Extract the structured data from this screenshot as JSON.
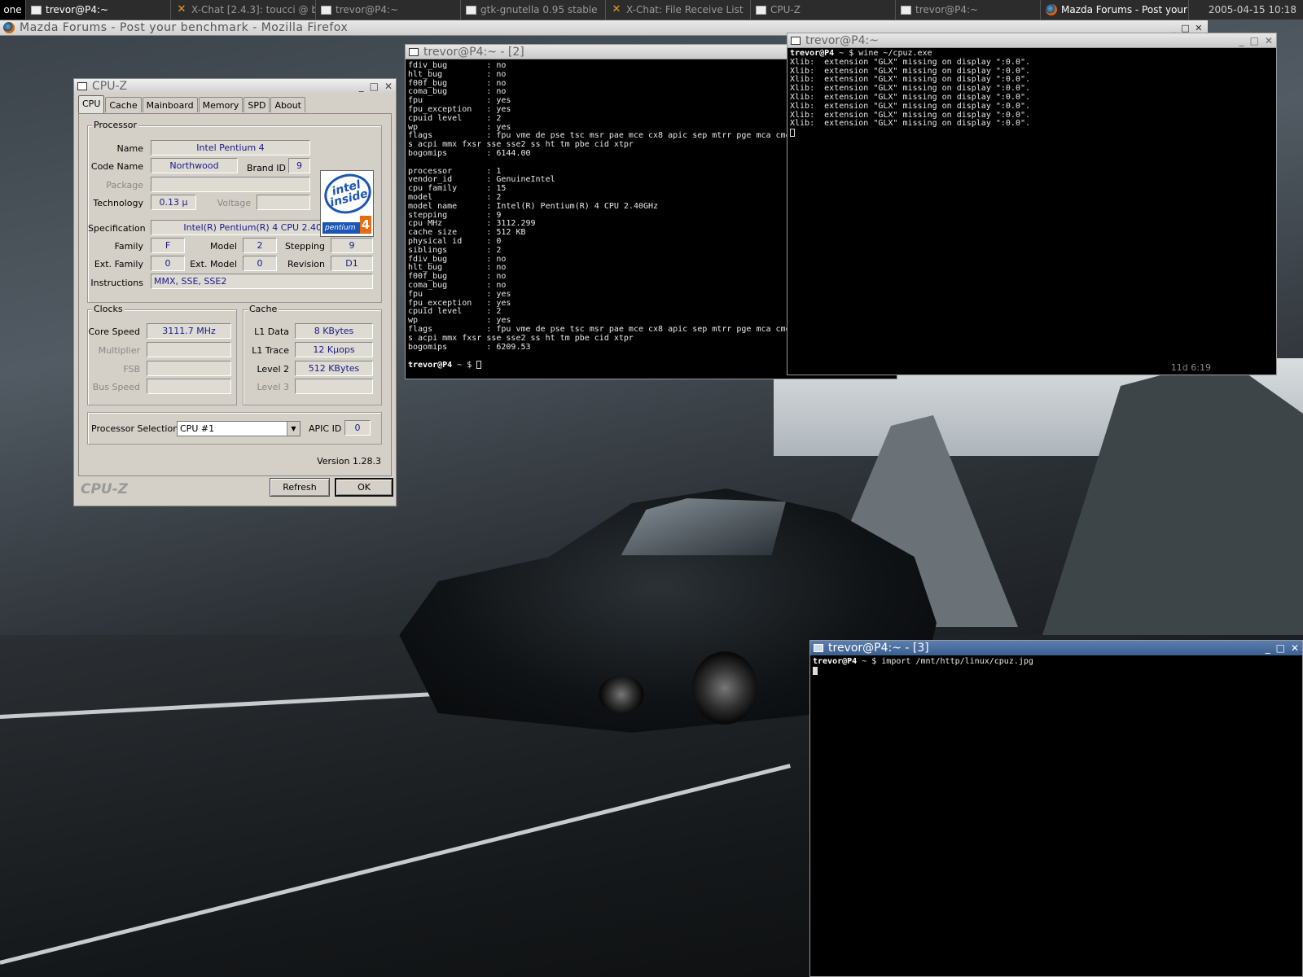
{
  "taskbar": {
    "workspace": "one",
    "tasks": [
      {
        "label": "trevor@P4:~",
        "icon": "terminal-icon"
      },
      {
        "label": "X-Chat [2.4.3]: toucci @ b",
        "icon": "xchat-icon"
      },
      {
        "label": "trevor@P4:~",
        "icon": "terminal-icon"
      },
      {
        "label": "gtk-gnutella 0.95 stable",
        "icon": "window-icon"
      },
      {
        "label": "X-Chat: File Receive List",
        "icon": "xchat-icon"
      },
      {
        "label": "CPU-Z",
        "icon": "window-icon"
      },
      {
        "label": "trevor@P4:~",
        "icon": "terminal-icon"
      },
      {
        "label": "Mazda Forums - Post your",
        "icon": "firefox-icon"
      }
    ],
    "clock": "2005-04-15 10:18"
  },
  "firefox": {
    "title": "Mazda Forums - Post your benchmark - Mozilla Firefox"
  },
  "term2": {
    "title": "trevor@P4:~ - [2]",
    "lines": [
      "fdiv_bug        : no",
      "hlt_bug         : no",
      "f00f_bug        : no",
      "coma_bug        : no",
      "fpu             : yes",
      "fpu_exception   : yes",
      "cpuid level     : 2",
      "wp              : yes",
      "flags           : fpu vme de pse tsc msr pae mce cx8 apic sep mtrr pge mca cmo",
      "s acpi mmx fxsr sse sse2 ss ht tm pbe cid xtpr",
      "bogomips        : 6144.00",
      "",
      "processor       : 1",
      "vendor_id       : GenuineIntel",
      "cpu family      : 15",
      "model           : 2",
      "model name      : Intel(R) Pentium(R) 4 CPU 2.40GHz",
      "stepping        : 9",
      "cpu MHz         : 3112.299",
      "cache size      : 512 KB",
      "physical id     : 0",
      "siblings        : 2",
      "fdiv_bug        : no",
      "hlt_bug         : no",
      "f00f_bug        : no",
      "coma_bug        : no",
      "fpu             : yes",
      "fpu_exception   : yes",
      "cpuid level     : 2",
      "wp              : yes",
      "flags           : fpu vme de pse tsc msr pae mce cx8 apic sep mtrr pge mca cmo",
      "s acpi mmx fxsr sse sse2 ss ht tm pbe cid xtpr",
      "bogomips        : 6209.53"
    ],
    "prompt_user": "trevor@P4",
    "prompt_rest": " ~ $ "
  },
  "term1": {
    "title": "trevor@P4:~",
    "prompt_user": "trevor@P4",
    "prompt_rest": " ~ $ wine ~/cpuz.exe",
    "lines": [
      "Xlib:  extension \"GLX\" missing on display \":0.0\".",
      "Xlib:  extension \"GLX\" missing on display \":0.0\".",
      "Xlib:  extension \"GLX\" missing on display \":0.0\".",
      "Xlib:  extension \"GLX\" missing on display \":0.0\".",
      "Xlib:  extension \"GLX\" missing on display \":0.0\".",
      "Xlib:  extension \"GLX\" missing on display \":0.0\".",
      "Xlib:  extension \"GLX\" missing on display \":0.0\".",
      "Xlib:  extension \"GLX\" missing on display \":0.0\"."
    ],
    "status": "11d 6:19"
  },
  "term3": {
    "title": "trevor@P4:~ - [3]",
    "prompt_user": "trevor@P4",
    "prompt_rest": " ~ $ import /mnt/http/linux/cpuz.jpg"
  },
  "cpuz": {
    "title": "CPU-Z",
    "tabs": [
      "CPU",
      "Cache",
      "Mainboard",
      "Memory",
      "SPD",
      "About"
    ],
    "processor": {
      "group": "Processor",
      "name_label": "Name",
      "name": "Intel Pentium 4",
      "codename_label": "Code Name",
      "codename": "Northwood",
      "brandid_label": "Brand ID",
      "brandid": "9",
      "package_label": "Package",
      "package": "",
      "technology_label": "Technology",
      "technology": "0.13 µ",
      "voltage_label": "Voltage",
      "voltage": "",
      "spec_label": "Specification",
      "spec": "Intel(R) Pentium(R) 4 CPU 2.40GHz",
      "family_label": "Family",
      "family": "F",
      "model_label": "Model",
      "model": "2",
      "stepping_label": "Stepping",
      "stepping": "9",
      "extfamily_label": "Ext. Family",
      "extfamily": "0",
      "extmodel_label": "Ext. Model",
      "extmodel": "0",
      "revision_label": "Revision",
      "revision": "D1",
      "instructions_label": "Instructions",
      "instructions": "MMX, SSE, SSE2"
    },
    "logo": {
      "line1": "intel",
      "line2": "inside",
      "product": "pentium",
      "four": "4"
    },
    "clocks": {
      "group": "Clocks",
      "core_label": "Core Speed",
      "core": "3111.7 MHz",
      "mult_label": "Multiplier",
      "mult": "",
      "fsb_label": "FSB",
      "fsb": "",
      "bus_label": "Bus Speed",
      "bus": ""
    },
    "cache": {
      "group": "Cache",
      "l1d_label": "L1 Data",
      "l1d": "8 KBytes",
      "l1t_label": "L1 Trace",
      "l1t": "12 Kµops",
      "l2_label": "Level 2",
      "l2": "512 KBytes",
      "l3_label": "Level 3",
      "l3": ""
    },
    "selection_label": "Processor Selection",
    "selection": "CPU #1",
    "apic_label": "APIC ID",
    "apic": "0",
    "version": "Version 1.28.3",
    "brand": "CPU-Z",
    "refresh": "Refresh",
    "ok": "OK"
  }
}
